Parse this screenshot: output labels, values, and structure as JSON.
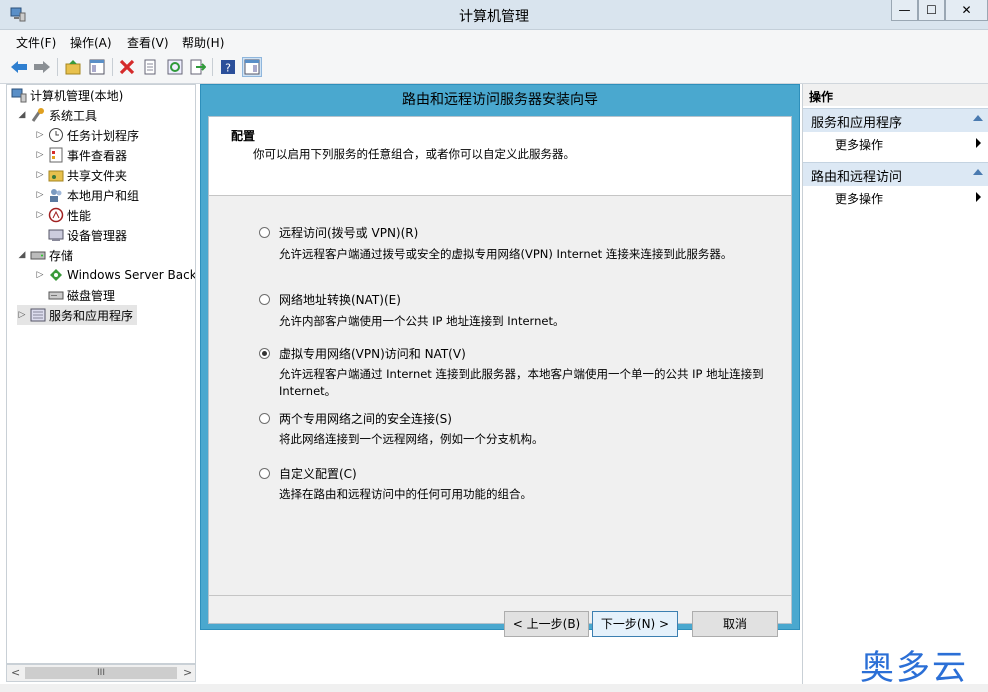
{
  "window": {
    "title": "计算机管理",
    "min": "—",
    "max": "☐",
    "close": "✕"
  },
  "menu": [
    "文件(F)",
    "操作(A)",
    "查看(V)",
    "帮助(H)"
  ],
  "tree": [
    {
      "label": "计算机管理(本地)",
      "level": 0,
      "arrow": ""
    },
    {
      "label": "系统工具",
      "level": 1,
      "arrow": "◢"
    },
    {
      "label": "任务计划程序",
      "level": 2,
      "arrow": "▷"
    },
    {
      "label": "事件查看器",
      "level": 2,
      "arrow": "▷"
    },
    {
      "label": "共享文件夹",
      "level": 2,
      "arrow": "▷"
    },
    {
      "label": "本地用户和组",
      "level": 2,
      "arrow": "▷"
    },
    {
      "label": "性能",
      "level": 2,
      "arrow": "▷"
    },
    {
      "label": "设备管理器",
      "level": 2,
      "arrow": ""
    },
    {
      "label": "存储",
      "level": 1,
      "arrow": "◢"
    },
    {
      "label": "Windows Server Back",
      "level": 2,
      "arrow": "▷"
    },
    {
      "label": "磁盘管理",
      "level": 2,
      "arrow": ""
    },
    {
      "label": "服务和应用程序",
      "level": 1,
      "arrow": "▷"
    }
  ],
  "scroll": {
    "left": "<",
    "right": ">",
    "thumb": "III"
  },
  "wizard": {
    "title": "路由和远程访问服务器安装向导",
    "header_title": "配置",
    "header_desc": "你可以启用下列服务的任意组合，或者你可以自定义此服务器。",
    "options": [
      {
        "label": "远程访问(拨号或 VPN)(R)",
        "desc": "允许远程客户端通过拨号或安全的虚拟专用网络(VPN) Internet 连接来连接到此服务器。",
        "selected": false
      },
      {
        "label": "网络地址转换(NAT)(E)",
        "desc": "允许内部客户端使用一个公共 IP 地址连接到 Internet。",
        "selected": false
      },
      {
        "label": "虚拟专用网络(VPN)访问和 NAT(V)",
        "desc": "允许远程客户端通过 Internet 连接到此服务器，本地客户端使用一个单一的公共 IP 地址连接到 Internet。",
        "selected": true
      },
      {
        "label": "两个专用网络之间的安全连接(S)",
        "desc": "将此网络连接到一个远程网络，例如一个分支机构。",
        "selected": false
      },
      {
        "label": "自定义配置(C)",
        "desc": "选择在路由和远程访问中的任何可用功能的组合。",
        "selected": false
      }
    ],
    "back": "< 上一步(B)",
    "next": "下一步(N) >",
    "cancel": "取消"
  },
  "actions": {
    "header": "操作",
    "groups": [
      {
        "title": "服务和应用程序",
        "item": "更多操作"
      },
      {
        "title": "路由和远程访问",
        "item": "更多操作"
      }
    ]
  },
  "watermark": "奥多云"
}
